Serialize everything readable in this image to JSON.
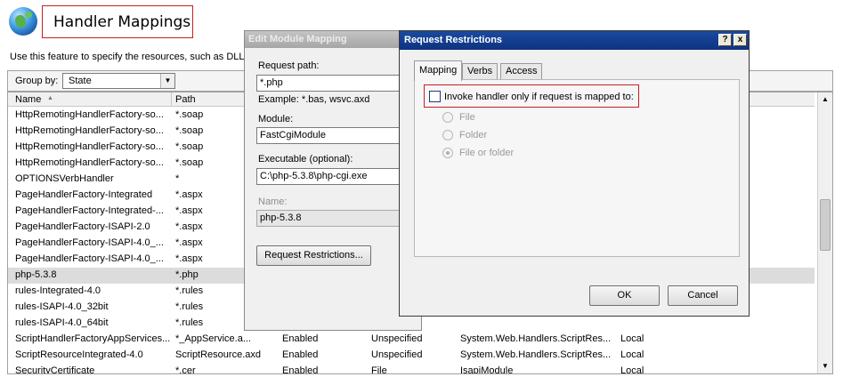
{
  "page": {
    "title": "Handler Mappings",
    "description": "Use this feature to specify the resources, such as DLLs",
    "group_by_label": "Group by:",
    "group_by_value": "State"
  },
  "grid": {
    "headers": [
      "Name",
      "Path"
    ],
    "rows": [
      {
        "name": "HttpRemotingHandlerFactory-so...",
        "path": "*.soap",
        "state": "",
        "type": "",
        "handler": "",
        "entry": ""
      },
      {
        "name": "HttpRemotingHandlerFactory-so...",
        "path": "*.soap",
        "state": "",
        "type": "",
        "handler": "",
        "entry": ""
      },
      {
        "name": "HttpRemotingHandlerFactory-so...",
        "path": "*.soap",
        "state": "",
        "type": "",
        "handler": "",
        "entry": ""
      },
      {
        "name": "HttpRemotingHandlerFactory-so...",
        "path": "*.soap",
        "state": "",
        "type": "",
        "handler": "",
        "entry": ""
      },
      {
        "name": "OPTIONSVerbHandler",
        "path": "*",
        "state": "",
        "type": "",
        "handler": "",
        "entry": ""
      },
      {
        "name": "PageHandlerFactory-Integrated",
        "path": "*.aspx",
        "state": "",
        "type": "",
        "handler": "",
        "entry": ""
      },
      {
        "name": "PageHandlerFactory-Integrated-...",
        "path": "*.aspx",
        "state": "",
        "type": "",
        "handler": "",
        "entry": ""
      },
      {
        "name": "PageHandlerFactory-ISAPI-2.0",
        "path": "*.aspx",
        "state": "",
        "type": "",
        "handler": "",
        "entry": ""
      },
      {
        "name": "PageHandlerFactory-ISAPI-4.0_...",
        "path": "*.aspx",
        "state": "",
        "type": "",
        "handler": "",
        "entry": ""
      },
      {
        "name": "PageHandlerFactory-ISAPI-4.0_...",
        "path": "*.aspx",
        "state": "",
        "type": "",
        "handler": "",
        "entry": ""
      },
      {
        "name": "php-5.3.8",
        "path": "*.php",
        "state": "",
        "type": "",
        "handler": "",
        "entry": ""
      },
      {
        "name": "rules-Integrated-4.0",
        "path": "*.rules",
        "state": "",
        "type": "",
        "handler": "",
        "entry": ""
      },
      {
        "name": "rules-ISAPI-4.0_32bit",
        "path": "*.rules",
        "state": "",
        "type": "",
        "handler": "",
        "entry": ""
      },
      {
        "name": "rules-ISAPI-4.0_64bit",
        "path": "*.rules",
        "state": "",
        "type": "",
        "handler": "",
        "entry": ""
      },
      {
        "name": "ScriptHandlerFactoryAppServices...",
        "path": "*_AppService.a...",
        "state": "Enabled",
        "type": "Unspecified",
        "handler": "System.Web.Handlers.ScriptRes...",
        "entry": "Local"
      },
      {
        "name": "ScriptResourceIntegrated-4.0",
        "path": "ScriptResource.axd",
        "state": "Enabled",
        "type": "Unspecified",
        "handler": "System.Web.Handlers.ScriptRes...",
        "entry": "Local"
      },
      {
        "name": "SecurityCertificate",
        "path": "*.cer",
        "state": "Enabled",
        "type": "File",
        "handler": "IsapiModule",
        "entry": "Local"
      }
    ]
  },
  "edit_dialog": {
    "title": "Edit Module Mapping",
    "request_path_label": "Request path:",
    "request_path_value": "*.php",
    "example": "Example: *.bas, wsvc.axd",
    "module_label": "Module:",
    "module_value": "FastCgiModule",
    "executable_label": "Executable (optional):",
    "executable_value": "C:\\php-5.3.8\\php-cgi.exe",
    "name_label": "Name:",
    "name_value": "php-5.3.8",
    "request_restrictions_button": "Request Restrictions..."
  },
  "rr_dialog": {
    "title": "Request Restrictions",
    "help_glyph": "?",
    "close_glyph": "x",
    "tabs": [
      "Mapping",
      "Verbs",
      "Access"
    ],
    "checkbox_label": "Invoke handler only if request is mapped to:",
    "checkbox_checked": false,
    "options": [
      "File",
      "Folder",
      "File or folder"
    ],
    "selected_option": "File or folder",
    "ok": "OK",
    "cancel": "Cancel"
  }
}
